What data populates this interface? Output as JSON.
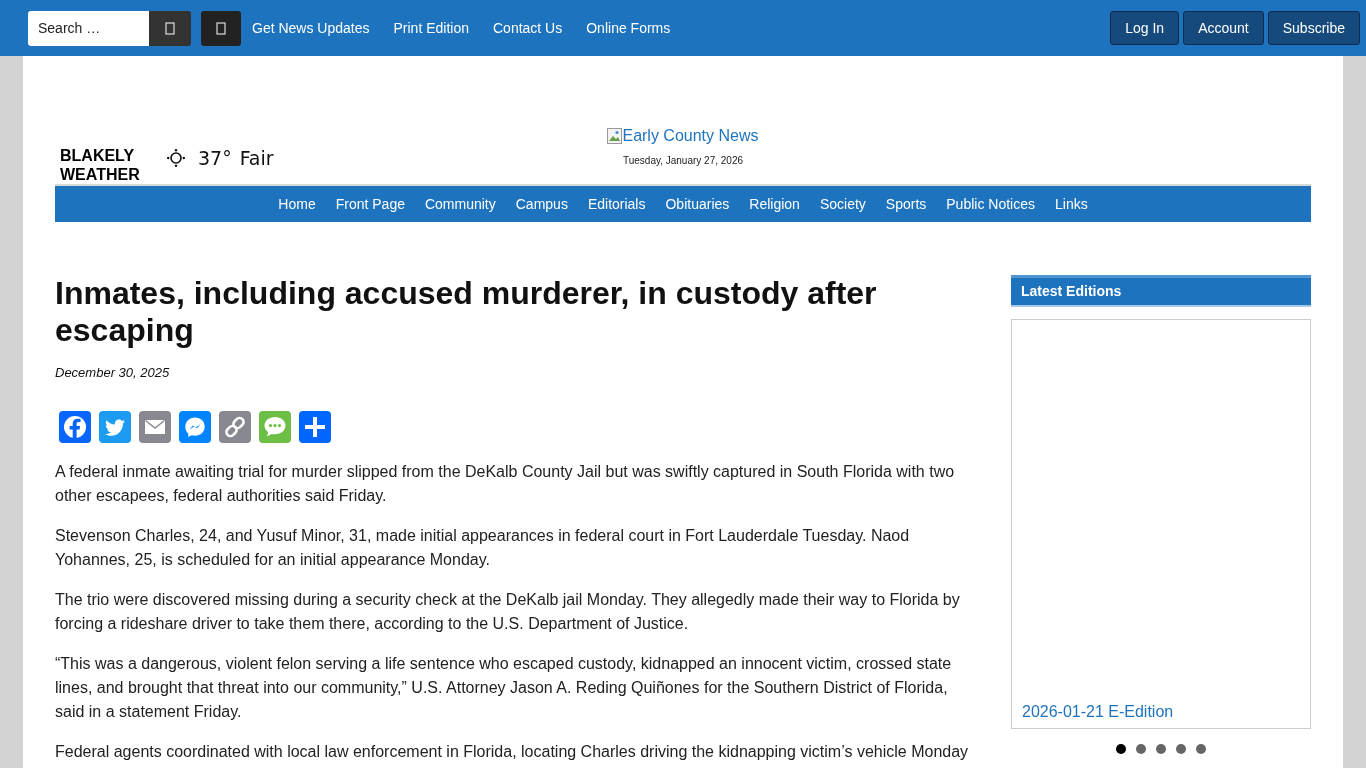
{
  "top_bar": {
    "search": {
      "placeholder": "Search …"
    },
    "links": [
      "Get News Updates",
      "Print Edition",
      "Contact Us",
      "Online Forms"
    ],
    "account_buttons": [
      "Log In",
      "Account",
      "Subscribe"
    ]
  },
  "weather": {
    "label": "BLAKELY WEATHER",
    "temperature": "37°",
    "condition": "Fair"
  },
  "masthead": {
    "logo_alt": "Early County News",
    "date": "Tuesday, January 27, 2026"
  },
  "main_nav": [
    "Home",
    "Front Page",
    "Community",
    "Campus",
    "Editorials",
    "Obituaries",
    "Religion",
    "Society",
    "Sports",
    "Public Notices",
    "Links"
  ],
  "article": {
    "title": "Inmates, including accused murderer, in custody after escaping",
    "date": "December 30, 2025",
    "share_buttons": [
      {
        "kind": "facebook"
      },
      {
        "kind": "twitter"
      },
      {
        "kind": "email"
      },
      {
        "kind": "messenger"
      },
      {
        "kind": "copy_link"
      },
      {
        "kind": "sms"
      },
      {
        "kind": "share"
      }
    ],
    "paragraphs": [
      "A federal inmate awaiting trial for murder slipped from the DeKalb County Jail but was swiftly captured in South Florida with two other escapees, federal authorities said Friday.",
      "Stevenson Charles, 24, and Yusuf Minor, 31, made initial appearances in federal court in Fort Lauderdale Tuesday. Naod Yohannes, 25, is scheduled for an initial appearance Monday.",
      "The trio were discovered missing during a security check at the DeKalb jail Monday. They allegedly made their way to Florida by forcing a rideshare driver to take them there, according to the U.S. Department of Justice.",
      "“This was a dangerous, violent felon serving a life sentence who escaped custody, kidnapped an innocent victim, crossed state lines, and brought that threat into our community,” U.S. Attorney Jason A. Reding Quiñones for the Southern District of Florida, said in a statement Friday.",
      "Federal agents coordinated with local law enforcement in Florida, locating Charles driving the kidnapping victim’s vehicle Monday"
    ]
  },
  "sidebar": {
    "heading": "Latest Editions",
    "slide_caption": "2026-01-21 E-Edition",
    "dots": [
      {
        "selected": true
      },
      {
        "selected": false
      },
      {
        "selected": false
      },
      {
        "selected": false
      },
      {
        "selected": false
      }
    ]
  }
}
